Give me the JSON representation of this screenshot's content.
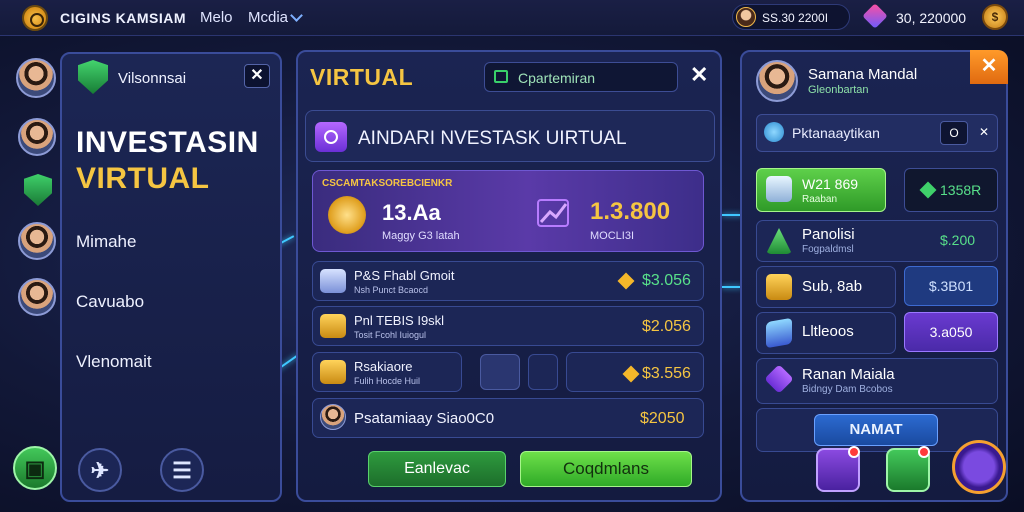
{
  "topbar": {
    "title": "CIGINS KAMSIAM",
    "link1": "Melo",
    "link2": "Mcdia",
    "coins": "SS.30 2200I",
    "gems": "30, 220000",
    "gold_label": "$"
  },
  "left_panel": {
    "title": "Vilsonnsai",
    "close_label": "✕",
    "headline_line1": "INVESTASIN",
    "headline_line2": "VIRTUAL",
    "items": [
      "Mimahe",
      "Cavuabo",
      "Vlenomait"
    ]
  },
  "center_panel": {
    "title": "VIRTUAL",
    "tag": "Cpartemiran",
    "close_label": "✕",
    "subtitle": "AINDARI NVESTASK UIRTUAL",
    "promo": {
      "label": "CSCAMTAKSOREBCIENKR",
      "value1": "13.Aa",
      "sub1": "Maggy G3 latah",
      "value2": "1.3.800",
      "sub2": "MOCLI3I"
    },
    "rows": [
      {
        "title": "P&S Fhabl Gmoit",
        "sub": "Nsh Punct Bcaocd",
        "value": "$3.056"
      },
      {
        "title": "Pnl TEBIS I9skl",
        "sub": "Tosit Fcohl Iuiogul",
        "value": "$2.056"
      },
      {
        "title": "Rsakiaore",
        "sub": "Fulih Hocde Huil",
        "value": "$3.556"
      },
      {
        "title": "Psatamiaay Siao0C0",
        "sub": "",
        "value": "$2050"
      }
    ],
    "btn_secondary": "Eanlevac",
    "btn_primary": "Coqdmlans"
  },
  "right_panel": {
    "close_label": "✕",
    "name": "Samana Mandal",
    "sub": "Gleonbartan",
    "search_text": "Pktanaaytikan",
    "search_btn1": "O",
    "search_btn2": "✕",
    "featured": {
      "title": "W21 869",
      "sub": "Raaban",
      "value": "1358R"
    },
    "rows": [
      {
        "title": "Panolisi",
        "sub": "Fogpaldmsl",
        "value": "$.200"
      },
      {
        "title": "Sub, 8ab",
        "sub": "",
        "value": "$.3B01"
      },
      {
        "title": "Lltleoos",
        "sub": "",
        "value": "3.a050"
      },
      {
        "title": "Ranan Maiala",
        "sub": "Bidngy Dam Bcobos",
        "value": ""
      }
    ],
    "action_btn": "NAMAT"
  },
  "colors": {
    "accent_gold": "#f5c542",
    "accent_green": "#3fd06a",
    "accent_purple": "#6b4bd0",
    "panel_border": "#3a4c9a"
  }
}
